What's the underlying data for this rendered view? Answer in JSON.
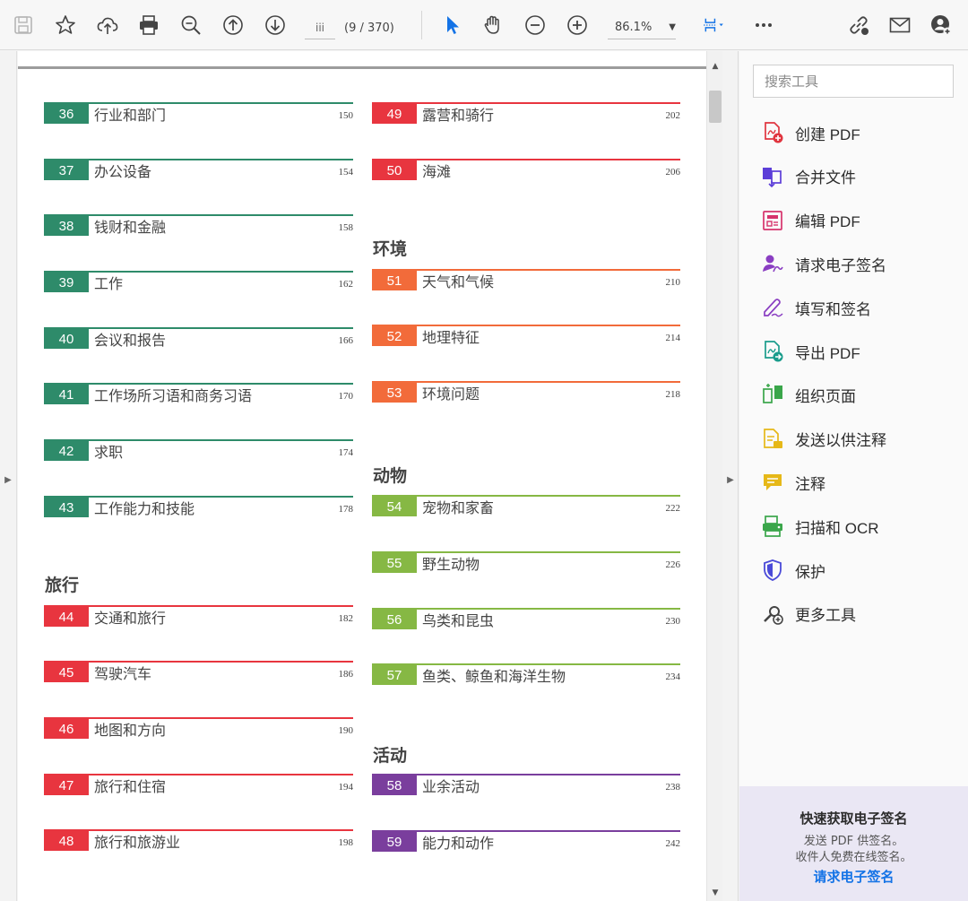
{
  "toolbar": {
    "page_input": "iii",
    "page_count": "(9 / 370)",
    "zoom": "86.1%",
    "icons": [
      "save-icon",
      "star-icon",
      "cloud-upload-icon",
      "print-icon",
      "zoom-search-icon",
      "page-up-icon",
      "page-down-icon",
      "select-arrow-icon",
      "hand-icon",
      "zoom-out-icon",
      "zoom-in-icon",
      "fit-page-icon",
      "more-icon",
      "link-icon",
      "mail-icon",
      "account-icon"
    ],
    "accent": "#1473e6"
  },
  "document": {
    "left_column": [
      {
        "num": "36",
        "label": "行业和部门",
        "page": "150",
        "color": "#2e8b6a"
      },
      {
        "num": "37",
        "label": "办公设备",
        "page": "154",
        "color": "#2e8b6a"
      },
      {
        "num": "38",
        "label": "钱财和金融",
        "page": "158",
        "color": "#2e8b6a"
      },
      {
        "num": "39",
        "label": "工作",
        "page": "162",
        "color": "#2e8b6a"
      },
      {
        "num": "40",
        "label": "会议和报告",
        "page": "166",
        "color": "#2e8b6a"
      },
      {
        "num": "41",
        "label": "工作场所习语和商务习语",
        "page": "170",
        "color": "#2e8b6a"
      },
      {
        "num": "42",
        "label": "求职",
        "page": "174",
        "color": "#2e8b6a"
      },
      {
        "num": "43",
        "label": "工作能力和技能",
        "page": "178",
        "color": "#2e8b6a"
      }
    ],
    "section_travel": "旅行",
    "travel": [
      {
        "num": "44",
        "label": "交通和旅行",
        "page": "182",
        "color": "#e8353f"
      },
      {
        "num": "45",
        "label": "驾驶汽车",
        "page": "186",
        "color": "#e8353f"
      },
      {
        "num": "46",
        "label": "地图和方向",
        "page": "190",
        "color": "#e8353f"
      },
      {
        "num": "47",
        "label": "旅行和住宿",
        "page": "194",
        "color": "#e8353f"
      },
      {
        "num": "48",
        "label": "旅行和旅游业",
        "page": "198",
        "color": "#e8353f"
      }
    ],
    "right_top": [
      {
        "num": "49",
        "label": "露营和骑行",
        "page": "202",
        "color": "#e8353f"
      },
      {
        "num": "50",
        "label": "海滩",
        "page": "206",
        "color": "#e8353f"
      }
    ],
    "section_env": "环境",
    "env": [
      {
        "num": "51",
        "label": "天气和气候",
        "page": "210",
        "color": "#f26b3a"
      },
      {
        "num": "52",
        "label": "地理特征",
        "page": "214",
        "color": "#f26b3a"
      },
      {
        "num": "53",
        "label": "环境问题",
        "page": "218",
        "color": "#f26b3a"
      }
    ],
    "section_animals": "动物",
    "animals": [
      {
        "num": "54",
        "label": "宠物和家畜",
        "page": "222",
        "color": "#86b844"
      },
      {
        "num": "55",
        "label": "野生动物",
        "page": "226",
        "color": "#86b844"
      },
      {
        "num": "56",
        "label": "鸟类和昆虫",
        "page": "230",
        "color": "#86b844"
      },
      {
        "num": "57",
        "label": "鱼类、鲸鱼和海洋生物",
        "page": "234",
        "color": "#86b844"
      }
    ],
    "section_activities": "活动",
    "activities": [
      {
        "num": "58",
        "label": "业余活动",
        "page": "238",
        "color": "#7a3e9d"
      },
      {
        "num": "59",
        "label": "能力和动作",
        "page": "242",
        "color": "#7a3e9d"
      }
    ]
  },
  "tools": {
    "search_placeholder": "搜索工具",
    "items": [
      {
        "label": "创建 PDF",
        "icon": "create-pdf-icon",
        "color": "#e0353f"
      },
      {
        "label": "合并文件",
        "icon": "combine-files-icon",
        "color": "#5c3ed8"
      },
      {
        "label": "编辑 PDF",
        "icon": "edit-pdf-icon",
        "color": "#d6336c"
      },
      {
        "label": "请求电子签名",
        "icon": "request-signature-icon",
        "color": "#8a3ec2"
      },
      {
        "label": "填写和签名",
        "icon": "fill-sign-icon",
        "color": "#8a3ec2"
      },
      {
        "label": "导出 PDF",
        "icon": "export-pdf-icon",
        "color": "#1a9c8c"
      },
      {
        "label": "组织页面",
        "icon": "organize-pages-icon",
        "color": "#3aa64a"
      },
      {
        "label": "发送以供注释",
        "icon": "send-comment-icon",
        "color": "#e6b818"
      },
      {
        "label": "注释",
        "icon": "comment-icon",
        "color": "#e6b818"
      },
      {
        "label": "扫描和 OCR",
        "icon": "scan-ocr-icon",
        "color": "#3aa64a"
      },
      {
        "label": "保护",
        "icon": "protect-icon",
        "color": "#4a4ad8"
      },
      {
        "label": "更多工具",
        "icon": "more-tools-icon",
        "color": "#444444"
      }
    ],
    "promo": {
      "title": "快速获取电子签名",
      "line1": "发送 PDF 供签名。",
      "line2": "收件人免费在线签名。",
      "link": "请求电子签名"
    }
  }
}
